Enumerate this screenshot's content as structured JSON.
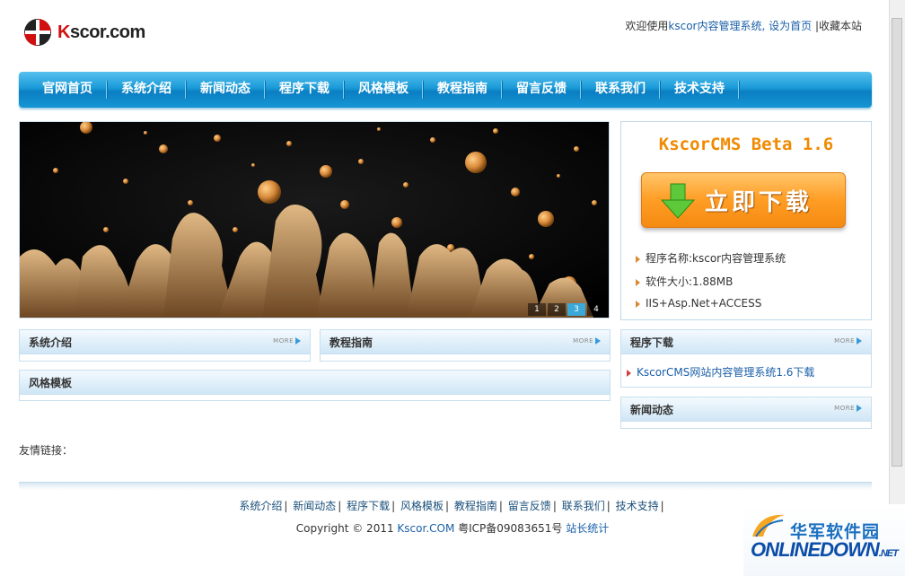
{
  "logo": {
    "prefix": "K",
    "text": "scor.com"
  },
  "toplinks": {
    "welcome": "欢迎使用",
    "product": "kscor内容管理系统",
    "set_home": ", 设为首页",
    "sep": " |",
    "favorite": "收藏本站"
  },
  "nav": {
    "items": [
      "官网首页",
      "系统介绍",
      "新闻动态",
      "程序下载",
      "风格模板",
      "教程指南",
      "留言反馈",
      "联系我们",
      "技术支持"
    ]
  },
  "banner": {
    "slides": [
      "1",
      "2",
      "3",
      "4"
    ],
    "active_slide": 3
  },
  "download": {
    "title": "KscorCMS Beta 1.6",
    "button_label": "立即下载",
    "info": [
      "程序名称:kscor内容管理系统",
      "软件大小:1.88MB",
      "IIS+Asp.Net+ACCESS"
    ]
  },
  "panels": {
    "intro": {
      "title": "系统介绍",
      "more": "MORE"
    },
    "guide": {
      "title": "教程指南",
      "more": "MORE"
    },
    "template": {
      "title": "风格模板"
    },
    "program": {
      "title": "程序下载",
      "more": "MORE",
      "link": "KscorCMS网站内容管理系统1.6下载"
    },
    "news": {
      "title": "新闻动态",
      "more": "MORE"
    }
  },
  "friend_links": "友情链接：",
  "footer": {
    "links": [
      "系统介绍",
      "新闻动态",
      "程序下载",
      "风格模板",
      "教程指南",
      "留言反馈",
      "联系我们",
      "技术支持"
    ],
    "copyright_prefix": "Copyright © 2011 ",
    "site": "Kscor.COM",
    "icp": " 粤ICP备09083651号 ",
    "stats": "站长统计"
  },
  "watermark": {
    "cn": "华军软件园",
    "en": "ONLINEDOWN",
    "net": ".NET"
  },
  "colors": {
    "nav_blue": "#1a9ad8",
    "download_orange": "#ff9d24",
    "title_orange": "#f08a00",
    "link_blue": "#1a5fa8"
  }
}
